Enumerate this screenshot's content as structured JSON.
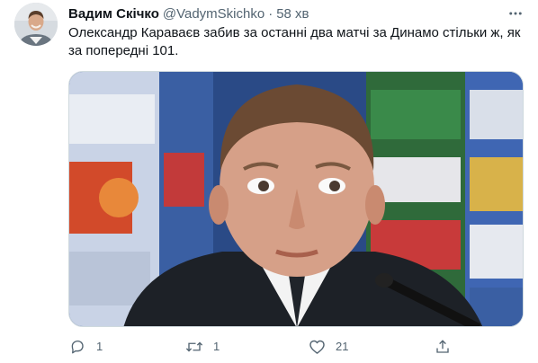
{
  "tweet": {
    "author": {
      "display_name": "Вадим Скічко",
      "handle": "@VadymSkichko",
      "avatar_icon": "user-avatar"
    },
    "separator": "·",
    "time": "58 хв",
    "text": "Олександр Караваєв забив за останні два матчі за Динамо стільки ж, як за попередні 101.",
    "media": {
      "description_icon": "photo"
    },
    "actions": {
      "reply": {
        "icon": "reply-icon",
        "count": "1"
      },
      "retweet": {
        "icon": "retweet-icon",
        "count": "1"
      },
      "like": {
        "icon": "heart-icon",
        "count": "21"
      },
      "share": {
        "icon": "share-icon"
      }
    },
    "more_icon": "more-icon"
  },
  "colors": {
    "text_primary": "#0f1419",
    "text_secondary": "#536471",
    "border": "#cfd9de"
  }
}
